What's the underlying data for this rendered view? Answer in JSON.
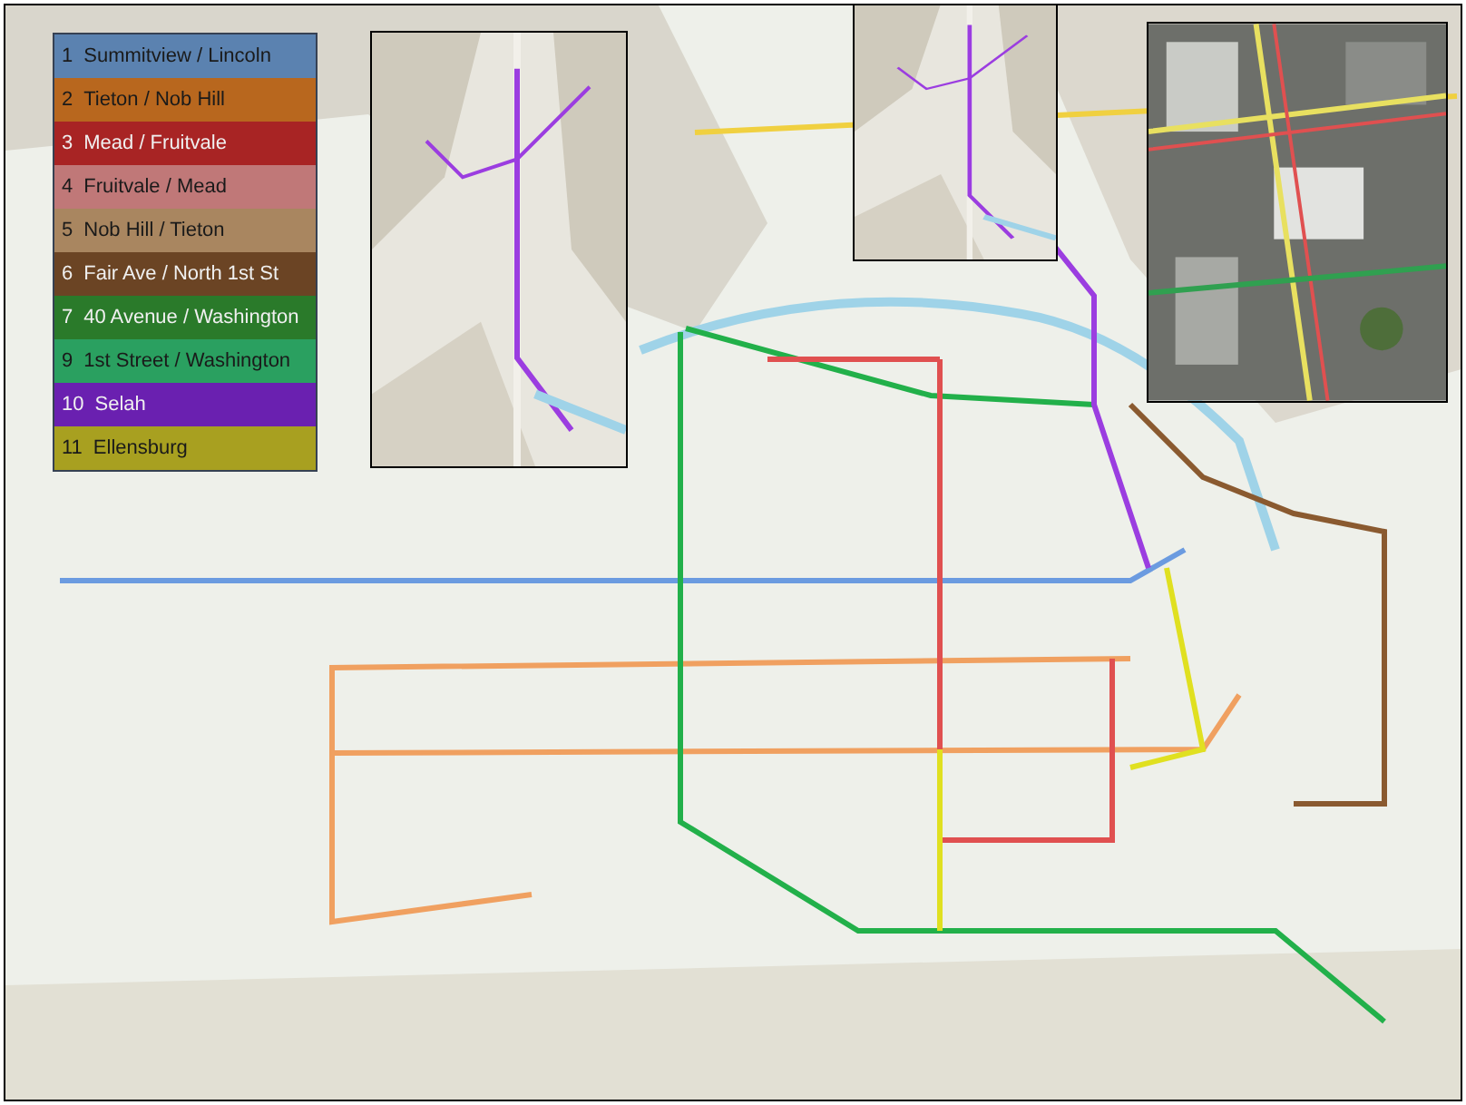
{
  "map": {
    "kind": "picture"
  },
  "legend": {
    "routes": [
      {
        "number": "1",
        "name": "Summitview / Lincoln",
        "color": "#5b82b0"
      },
      {
        "number": "2",
        "name": "Tieton / Nob Hill",
        "color": "#b8671e"
      },
      {
        "number": "3",
        "name": "Mead / Fruitvale",
        "color": "#a82424"
      },
      {
        "number": "4",
        "name": "Fruitvale / Mead",
        "color": "#c07878"
      },
      {
        "number": "5",
        "name": "Nob Hill / Tieton",
        "color": "#a98660"
      },
      {
        "number": "6",
        "name": "Fair Ave / North 1st St",
        "color": "#6b4424"
      },
      {
        "number": "7",
        "name": "40 Avenue / Washington",
        "color": "#2a7a2a"
      },
      {
        "number": "9",
        "name": "1st Street / Washington",
        "color": "#2aa060"
      },
      {
        "number": "10",
        "name": "Selah",
        "color": "#6a20b0"
      },
      {
        "number": "11",
        "name": "Ellensburg",
        "color": "#a8a020"
      }
    ]
  },
  "insets": [
    {
      "kind": "picture"
    },
    {
      "kind": "picture"
    },
    {
      "kind": "aerial"
    }
  ]
}
